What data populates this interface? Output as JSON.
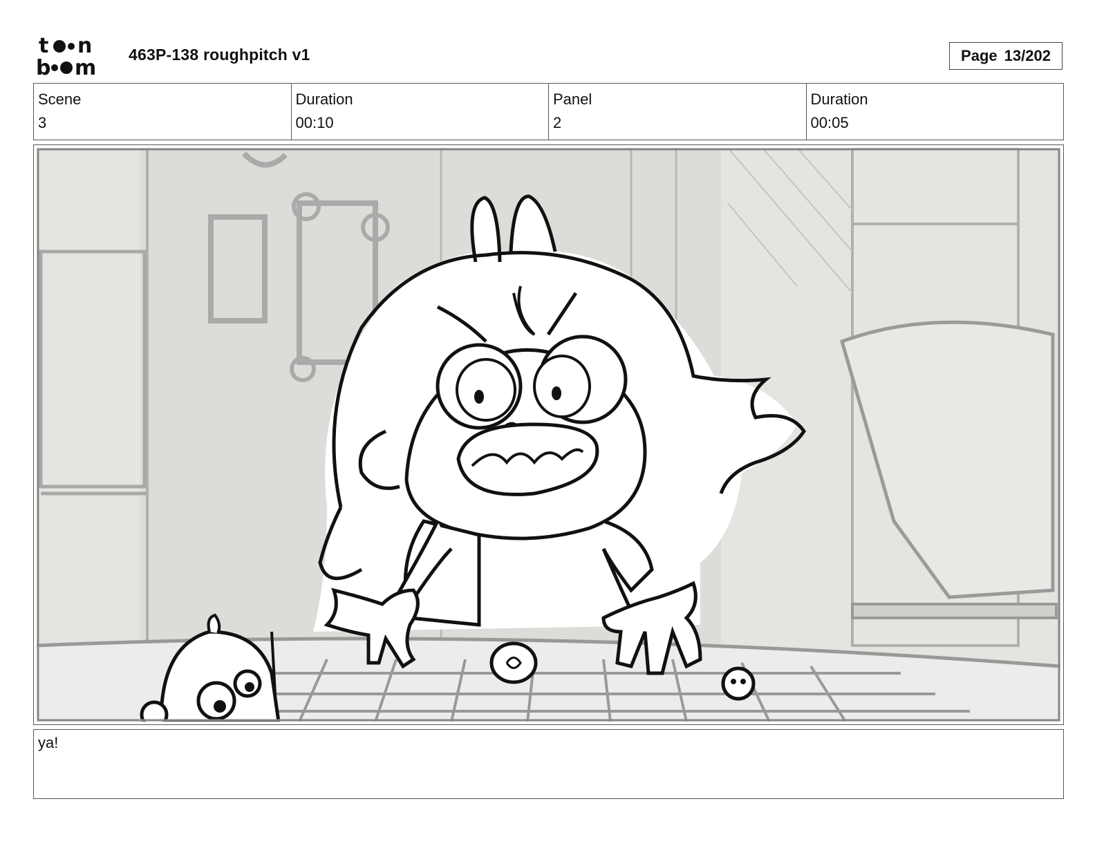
{
  "header": {
    "logo_text": "toon boom",
    "project_title": "463P-138 roughpitch v1",
    "page_label": "Page",
    "page_value": "13/202"
  },
  "info": {
    "scene_label": "Scene",
    "scene_value": "3",
    "scene_duration_label": "Duration",
    "scene_duration_value": "00:10",
    "panel_label": "Panel",
    "panel_value": "2",
    "panel_duration_label": "Duration",
    "panel_duration_value": "00:05"
  },
  "dialogue": {
    "text": "ya!"
  }
}
